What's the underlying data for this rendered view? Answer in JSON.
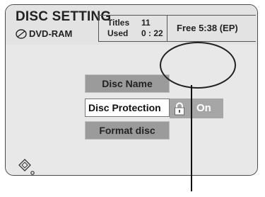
{
  "header": {
    "title": "DISC SETTING",
    "disc_type": "DVD-RAM",
    "titles_label": "Titles",
    "titles_value": "11",
    "used_label": "Used",
    "used_value": "0 : 22",
    "free_text": "Free 5:38 (EP)"
  },
  "menu": {
    "items": [
      {
        "label": "Disc Name"
      },
      {
        "label": "Disc Protection"
      },
      {
        "label": "Format disc"
      }
    ],
    "selected_index": 1
  },
  "protection_toggle": {
    "value": "On",
    "icon": "lock-icon"
  },
  "navigation": {
    "icon": "dpad-icon"
  }
}
